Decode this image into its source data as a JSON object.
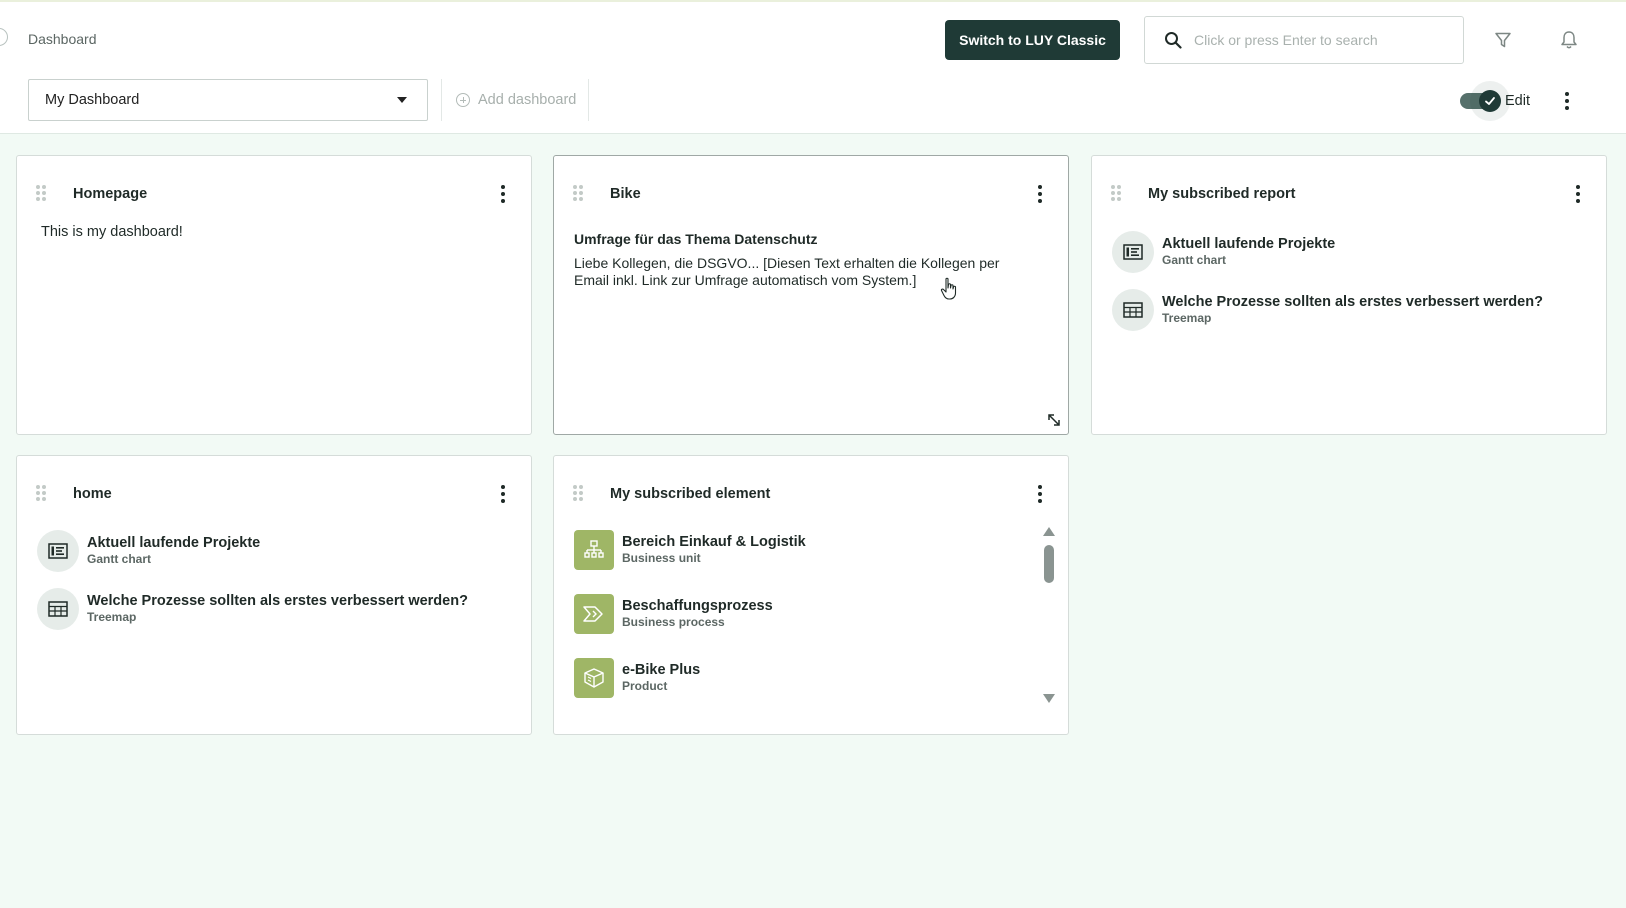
{
  "header": {
    "breadcrumb": "Dashboard",
    "switch_button": "Switch to LUY Classic",
    "search_placeholder": "Click or press Enter to search"
  },
  "toolbar": {
    "dashboard_selected": "My Dashboard",
    "add_dashboard": "Add dashboard",
    "edit_label": "Edit",
    "edit_enabled": true
  },
  "colors": {
    "accent_dark": "#1f3a36",
    "page_background": "#f2faf5",
    "element_icon_green": "#9fb666"
  },
  "widgets": {
    "homepage": {
      "title": "Homepage",
      "text": "This is my dashboard!"
    },
    "bike": {
      "title": "Bike",
      "message_title": "Umfrage für das Thema Datenschutz",
      "message_body": "Liebe Kollegen, die DSGVO... [Diesen Text erhalten die Kollegen per Email inkl. Link zur Umfrage automatisch vom System.]"
    },
    "subscribed_report": {
      "title": "My subscribed report",
      "items": [
        {
          "name": "Aktuell laufende Projekte",
          "type": "Gantt chart",
          "icon": "gantt-chart-icon"
        },
        {
          "name": "Welche Prozesse sollten als erstes verbessert werden?",
          "type": "Treemap",
          "icon": "treemap-icon"
        }
      ]
    },
    "home": {
      "title": "home",
      "items": [
        {
          "name": "Aktuell laufende Projekte",
          "type": "Gantt chart",
          "icon": "gantt-chart-icon"
        },
        {
          "name": "Welche Prozesse sollten als erstes verbessert werden?",
          "type": "Treemap",
          "icon": "treemap-icon"
        }
      ]
    },
    "subscribed_element": {
      "title": "My subscribed element",
      "items": [
        {
          "name": "Bereich Einkauf & Logistik",
          "type": "Business unit",
          "icon": "business-unit-icon"
        },
        {
          "name": "Beschaffungsprozess",
          "type": "Business process",
          "icon": "business-process-icon"
        },
        {
          "name": "e-Bike Plus",
          "type": "Product",
          "icon": "product-icon"
        }
      ]
    }
  }
}
